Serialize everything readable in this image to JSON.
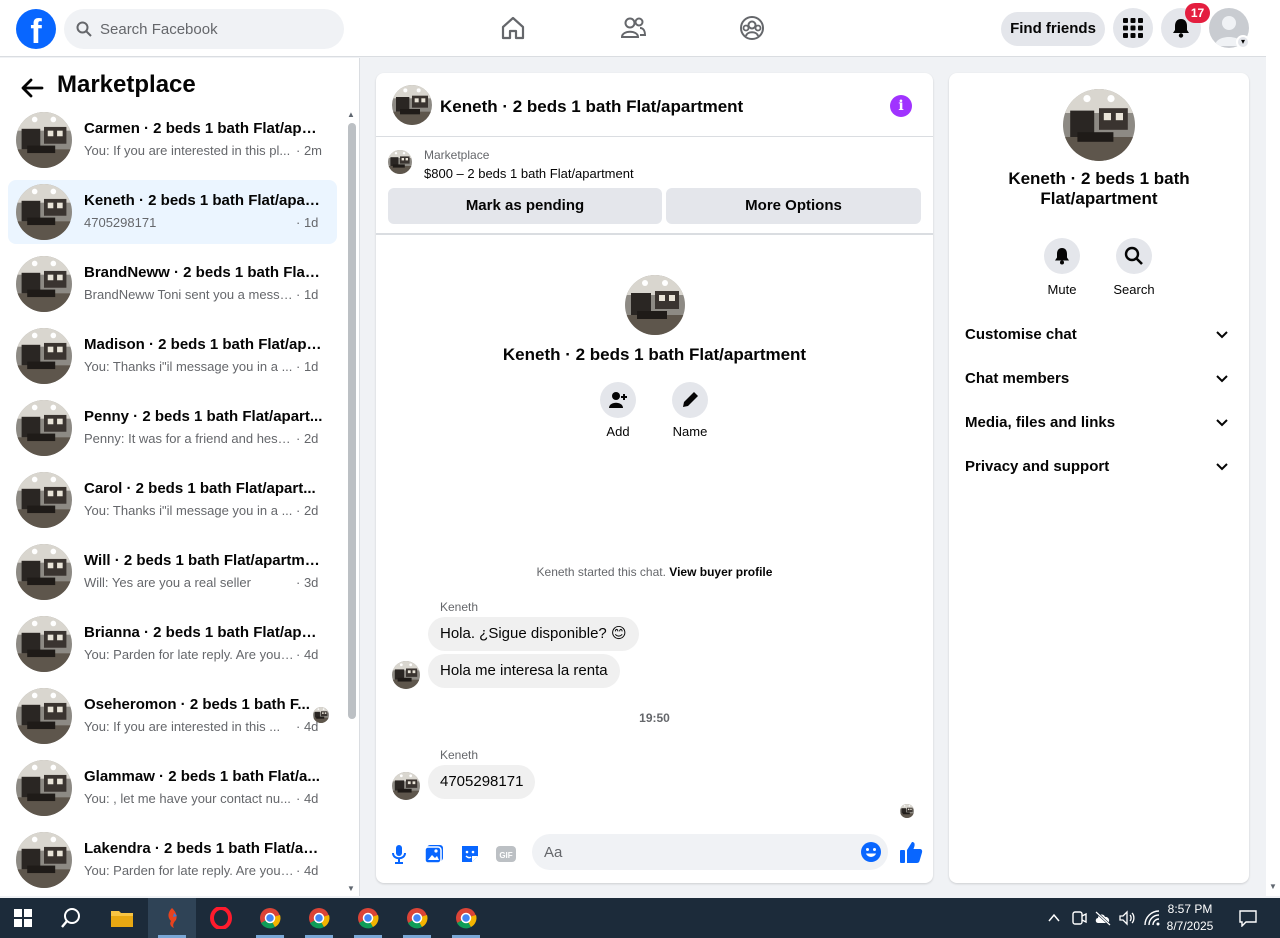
{
  "header": {
    "logo_letter": "f",
    "search_placeholder": "Search Facebook",
    "nav": [
      "home-icon",
      "friends-icon",
      "groups-icon"
    ],
    "find_friends_label": "Find friends",
    "notifications_count": "17"
  },
  "sidebar": {
    "title": "Marketplace",
    "conversations": [
      {
        "name": "Carmen · 2 beds 1 bath Flat/apar...",
        "preview": "You: If you are interested in this pl...",
        "time": "· 2m"
      },
      {
        "name": "Keneth · 2 beds 1 bath Flat/apart...",
        "preview": "4705298171",
        "time": "· 1d"
      },
      {
        "name": "BrandNeww · 2 beds 1 bath Flat/...",
        "preview": "BrandNeww Toni sent you a messa...",
        "time": "· 1d"
      },
      {
        "name": "Madison · 2 beds 1 bath Flat/apa...",
        "preview": "You: Thanks i\"il message you in a ...",
        "time": "· 1d"
      },
      {
        "name": "Penny · 2 beds 1 bath Flat/apart...",
        "preview": "Penny: It was for a friend and hes st...",
        "time": "· 2d"
      },
      {
        "name": "Carol · 2 beds 1 bath Flat/apart...",
        "preview": "You: Thanks i\"il message you in a ...",
        "time": "· 2d"
      },
      {
        "name": "Will · 2 beds 1 bath Flat/apartme...",
        "preview": "Will: Yes are you a real seller",
        "time": "· 3d"
      },
      {
        "name": "Brianna · 2 beds 1 bath Flat/apar...",
        "preview": "You: Parden for late reply. Are you ...",
        "time": "· 4d"
      },
      {
        "name": "Oseheromon · 2 beds 1 bath F...",
        "preview": "You: If you are interested in this ...",
        "time": "· 4d"
      },
      {
        "name": "Glammaw · 2 beds 1 bath Flat/a...",
        "preview": "You: , let me have your contact nu...",
        "time": "· 4d"
      },
      {
        "name": "Lakendra · 2 beds 1 bath Flat/ap...",
        "preview": "You: Parden for late reply. Are you ...",
        "time": "· 4d"
      }
    ]
  },
  "chat": {
    "title": "Keneth · 2 beds 1 bath Flat/apartment",
    "marketplace_label": "Marketplace",
    "listing": "$800 – 2 beds 1 bath Flat/apartment",
    "mark_pending": "Mark as pending",
    "more_options": "More Options",
    "profile_name": "Keneth · 2 beds 1 bath Flat/apartment",
    "add_label": "Add",
    "name_label": "Name",
    "started_text": "Keneth started this chat.",
    "view_buyer": "View buyer profile",
    "sender1": "Keneth",
    "msg1": "Hola. ¿Sigue disponible? 😊",
    "msg2": "Hola me interesa la renta",
    "time_sep": "19:50",
    "sender2": "Keneth",
    "msg3": "4705298171",
    "input_placeholder": "Aa"
  },
  "details": {
    "name": "Keneth · 2 beds 1 bath Flat/apartment",
    "mute": "Mute",
    "search": "Search",
    "sections": [
      "Customise chat",
      "Chat members",
      "Media, files and links",
      "Privacy and support"
    ]
  },
  "taskbar": {
    "time": "8:57 PM",
    "date": "8/7/2025"
  },
  "colors": {
    "brand": "#0866ff",
    "accent_purple": "#a033ff",
    "badge_red": "#e41e3f"
  }
}
